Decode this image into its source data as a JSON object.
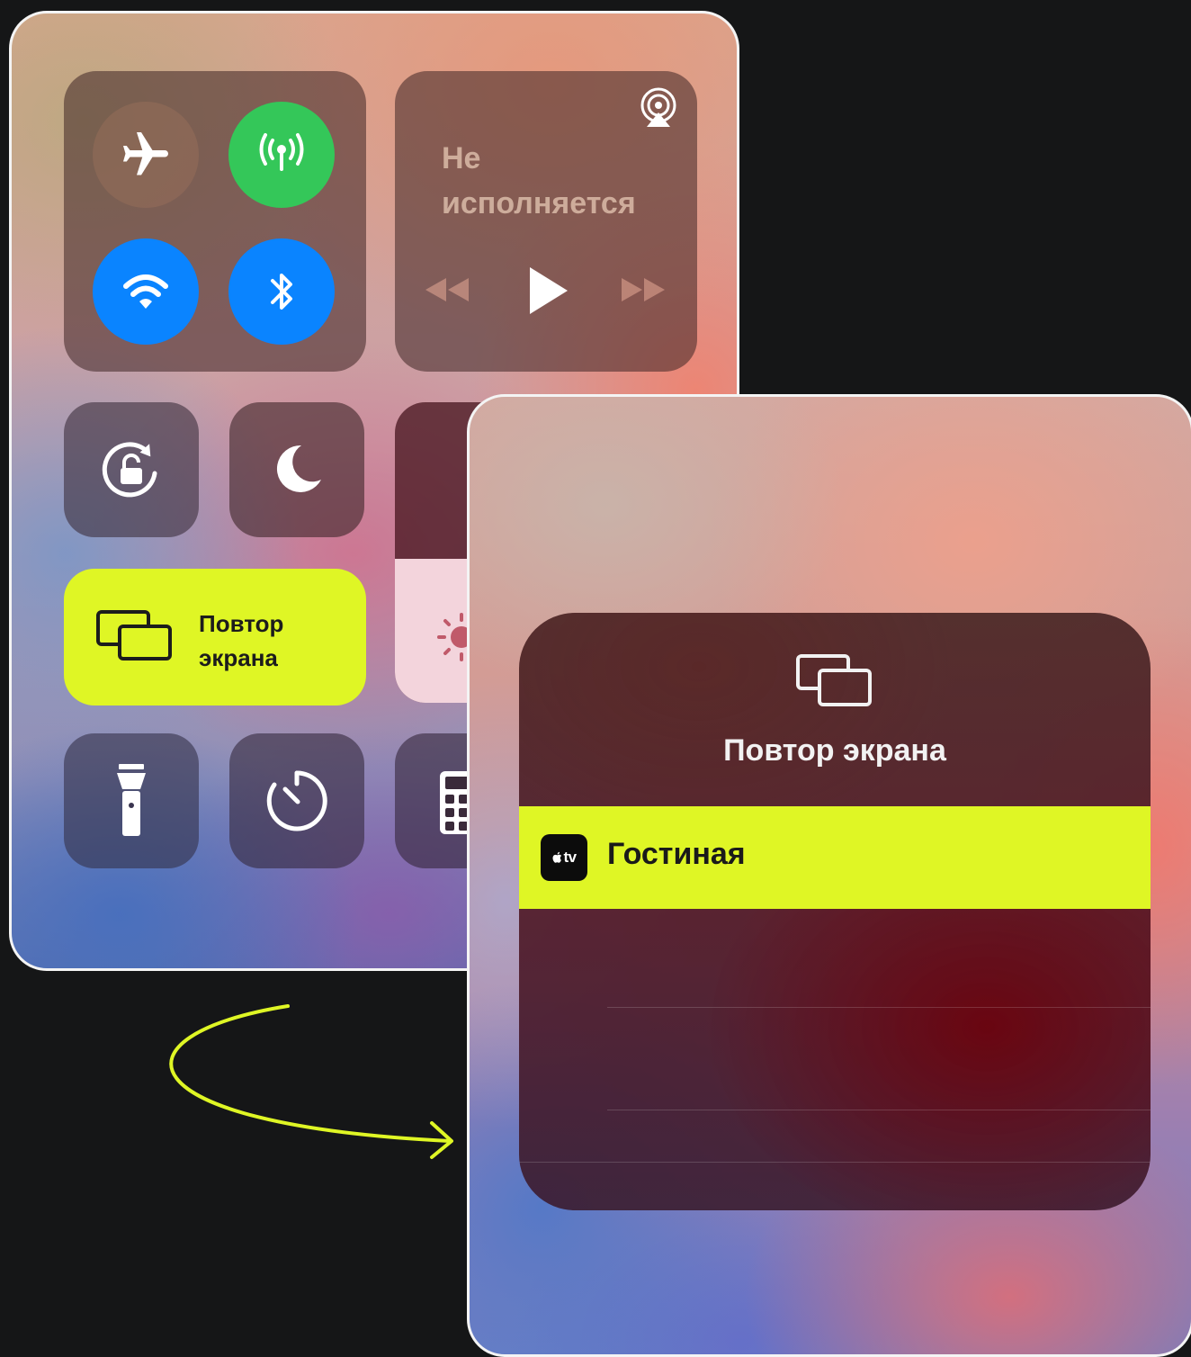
{
  "control_center": {
    "now_playing": {
      "title": "Не исполняется"
    },
    "screen_mirroring": {
      "label": "Повтор экрана"
    }
  },
  "mirroring_sheet": {
    "title": "Повтор экрана",
    "devices": [
      {
        "badge": "tv",
        "name": "Гостиная",
        "selected": true
      }
    ]
  },
  "colors": {
    "accent": "#dff625",
    "cellular_on": "#34c759",
    "wifi_bluetooth_on": "#0a84ff",
    "arrow": "#dff625"
  },
  "icons": [
    "airplane-icon",
    "cellular-icon",
    "wifi-icon",
    "bluetooth-icon",
    "airplay-icon",
    "rewind-icon",
    "play-icon",
    "forward-icon",
    "rotation-lock-icon",
    "moon-icon",
    "screen-mirroring-icon",
    "brightness-icon",
    "flashlight-icon",
    "timer-icon",
    "calculator-icon",
    "apple-logo-icon"
  ]
}
